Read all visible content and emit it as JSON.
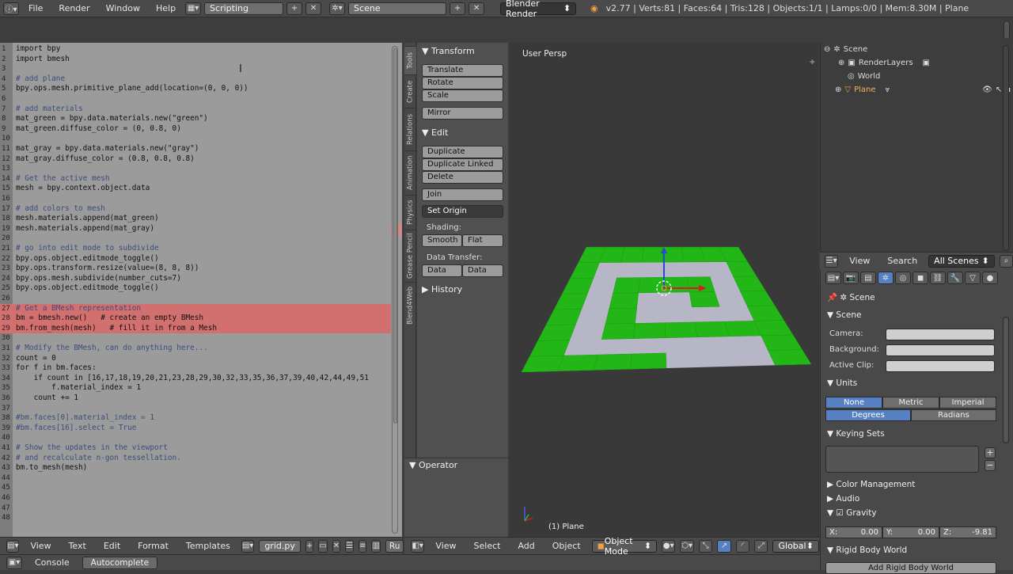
{
  "topbar": {
    "menus": [
      "File",
      "Render",
      "Window",
      "Help"
    ],
    "layout": "Scripting",
    "scene": "Scene",
    "engine": "Blender Render",
    "stats": "v2.77 | Verts:81 | Faces:64 | Tris:128 | Objects:1/1 | Lamps:0/0 | Mem:8.30M | Plane"
  },
  "editor": {
    "lines": [
      {
        "n": "1",
        "t": "import bpy",
        "hl": false
      },
      {
        "n": "2",
        "t": "import bmesh",
        "hl": false
      },
      {
        "n": "3",
        "t": "",
        "hl": false
      },
      {
        "n": "4",
        "t": "# add plane",
        "hl": false
      },
      {
        "n": "5",
        "t": "bpy.ops.mesh.primitive_plane_add(location=(0, 0, 0))",
        "hl": false
      },
      {
        "n": "6",
        "t": "",
        "hl": false
      },
      {
        "n": "7",
        "t": "# add materials",
        "hl": false
      },
      {
        "n": "8",
        "t": "mat_green = bpy.data.materials.new(\"green\")",
        "hl": false
      },
      {
        "n": "9",
        "t": "mat_green.diffuse_color = (0, 0.8, 0)",
        "hl": false
      },
      {
        "n": "10",
        "t": "",
        "hl": false
      },
      {
        "n": "11",
        "t": "mat_gray = bpy.data.materials.new(\"gray\")",
        "hl": false
      },
      {
        "n": "12",
        "t": "mat_gray.diffuse_color = (0.8, 0.8, 0.8)",
        "hl": false
      },
      {
        "n": "13",
        "t": "",
        "hl": false
      },
      {
        "n": "14",
        "t": "# Get the active mesh",
        "hl": false
      },
      {
        "n": "15",
        "t": "mesh = bpy.context.object.data",
        "hl": false
      },
      {
        "n": "16",
        "t": "",
        "hl": false
      },
      {
        "n": "17",
        "t": "# add colors to mesh",
        "hl": false
      },
      {
        "n": "18",
        "t": "mesh.materials.append(mat_green)",
        "hl": false
      },
      {
        "n": "19",
        "t": "mesh.materials.append(mat_gray)",
        "hl": false
      },
      {
        "n": "20",
        "t": "",
        "hl": false
      },
      {
        "n": "21",
        "t": "# go into edit mode to subdivide",
        "hl": false
      },
      {
        "n": "22",
        "t": "bpy.ops.object.editmode_toggle()",
        "hl": false
      },
      {
        "n": "23",
        "t": "bpy.ops.transform.resize(value=(8, 8, 8))",
        "hl": false
      },
      {
        "n": "24",
        "t": "bpy.ops.mesh.subdivide(number_cuts=7)",
        "hl": false
      },
      {
        "n": "25",
        "t": "bpy.ops.object.editmode_toggle()",
        "hl": false
      },
      {
        "n": "26",
        "t": "",
        "hl": false
      },
      {
        "n": "27",
        "t": "# Get a BMesh representation",
        "hl": true
      },
      {
        "n": "28",
        "t": "bm = bmesh.new()   # create an empty BMesh",
        "hl": true
      },
      {
        "n": "29",
        "t": "bm.from_mesh(mesh)   # fill it in from a Mesh",
        "hl": true
      },
      {
        "n": "30",
        "t": "",
        "hl": false
      },
      {
        "n": "31",
        "t": "# Modify the BMesh, can do anything here...",
        "hl": false
      },
      {
        "n": "32",
        "t": "count = 0",
        "hl": false
      },
      {
        "n": "33",
        "t": "for f in bm.faces:",
        "hl": false
      },
      {
        "n": "34",
        "t": "    if count in [16,17,18,19,20,21,23,28,29,30,32,33,35,36,37,39,40,42,44,49,51",
        "hl": false
      },
      {
        "n": "35",
        "t": "        f.material_index = 1",
        "hl": false
      },
      {
        "n": "36",
        "t": "    count += 1",
        "hl": false
      },
      {
        "n": "37",
        "t": "",
        "hl": false
      },
      {
        "n": "38",
        "t": "#bm.faces[0].material_index = 1",
        "hl": false
      },
      {
        "n": "39",
        "t": "#bm.faces[16].select = True",
        "hl": false
      },
      {
        "n": "40",
        "t": "",
        "hl": false
      },
      {
        "n": "41",
        "t": "# Show the updates in the viewport",
        "hl": false
      },
      {
        "n": "42",
        "t": "# and recalculate n-gon tessellation.",
        "hl": false
      },
      {
        "n": "43",
        "t": "bm.to_mesh(mesh)",
        "hl": false
      },
      {
        "n": "44",
        "t": "",
        "hl": false
      },
      {
        "n": "45",
        "t": "",
        "hl": false
      },
      {
        "n": "46",
        "t": "",
        "hl": false
      },
      {
        "n": "47",
        "t": "",
        "hl": false
      },
      {
        "n": "48",
        "t": "",
        "hl": false
      }
    ],
    "header_menus": [
      "View",
      "Text",
      "Edit",
      "Format",
      "Templates"
    ],
    "filename": "grid.py",
    "run_label": "Ru"
  },
  "bottom": {
    "console": "Console",
    "autocomplete": "Autocomplete"
  },
  "tools": {
    "tabs": [
      "Tools",
      "Create",
      "Relations",
      "Animation",
      "Physics",
      "Grease Pencil",
      "Blend4Web"
    ],
    "transform_header": "Transform",
    "translate": "Translate",
    "rotate": "Rotate",
    "scale": "Scale",
    "mirror": "Mirror",
    "edit_header": "Edit",
    "duplicate": "Duplicate",
    "duplicate_linked": "Duplicate Linked",
    "delete": "Delete",
    "join": "Join",
    "set_origin": "Set Origin",
    "shading_label": "Shading:",
    "smooth": "Smooth",
    "flat": "Flat",
    "data_transfer_label": "Data Transfer:",
    "data": "Data",
    "data_layout": "Data Layo",
    "history_header": "History",
    "operator_header": "Operator"
  },
  "viewport": {
    "label": "User Persp",
    "object_label": "(1) Plane",
    "header_menus": [
      "View",
      "Select",
      "Add",
      "Object"
    ],
    "mode": "Object Mode",
    "orientation": "Global",
    "green": "#22b716",
    "gray": "#b6b6c6"
  },
  "outliner": {
    "scene": "Scene",
    "render_layers": "RenderLayers",
    "world": "World",
    "plane": "Plane",
    "header_menus": [
      "View",
      "Search"
    ],
    "filter": "All Scenes"
  },
  "props": {
    "context": "Scene",
    "scene_header": "Scene",
    "camera_label": "Camera:",
    "background_label": "Background:",
    "active_clip_label": "Active Clip:",
    "units_header": "Units",
    "none": "None",
    "metric": "Metric",
    "imperial": "Imperial",
    "degrees": "Degrees",
    "radians": "Radians",
    "keying_header": "Keying Sets",
    "color_mgmt": "Color Management",
    "audio": "Audio",
    "gravity": "Gravity",
    "gx": "X:",
    "gx_val": "0.00",
    "gy": "Y:",
    "gy_val": "0.00",
    "gz": "Z:",
    "gz_val": "-9.81",
    "rigid": "Rigid Body World",
    "add_rigid": "Add Rigid Body World"
  }
}
